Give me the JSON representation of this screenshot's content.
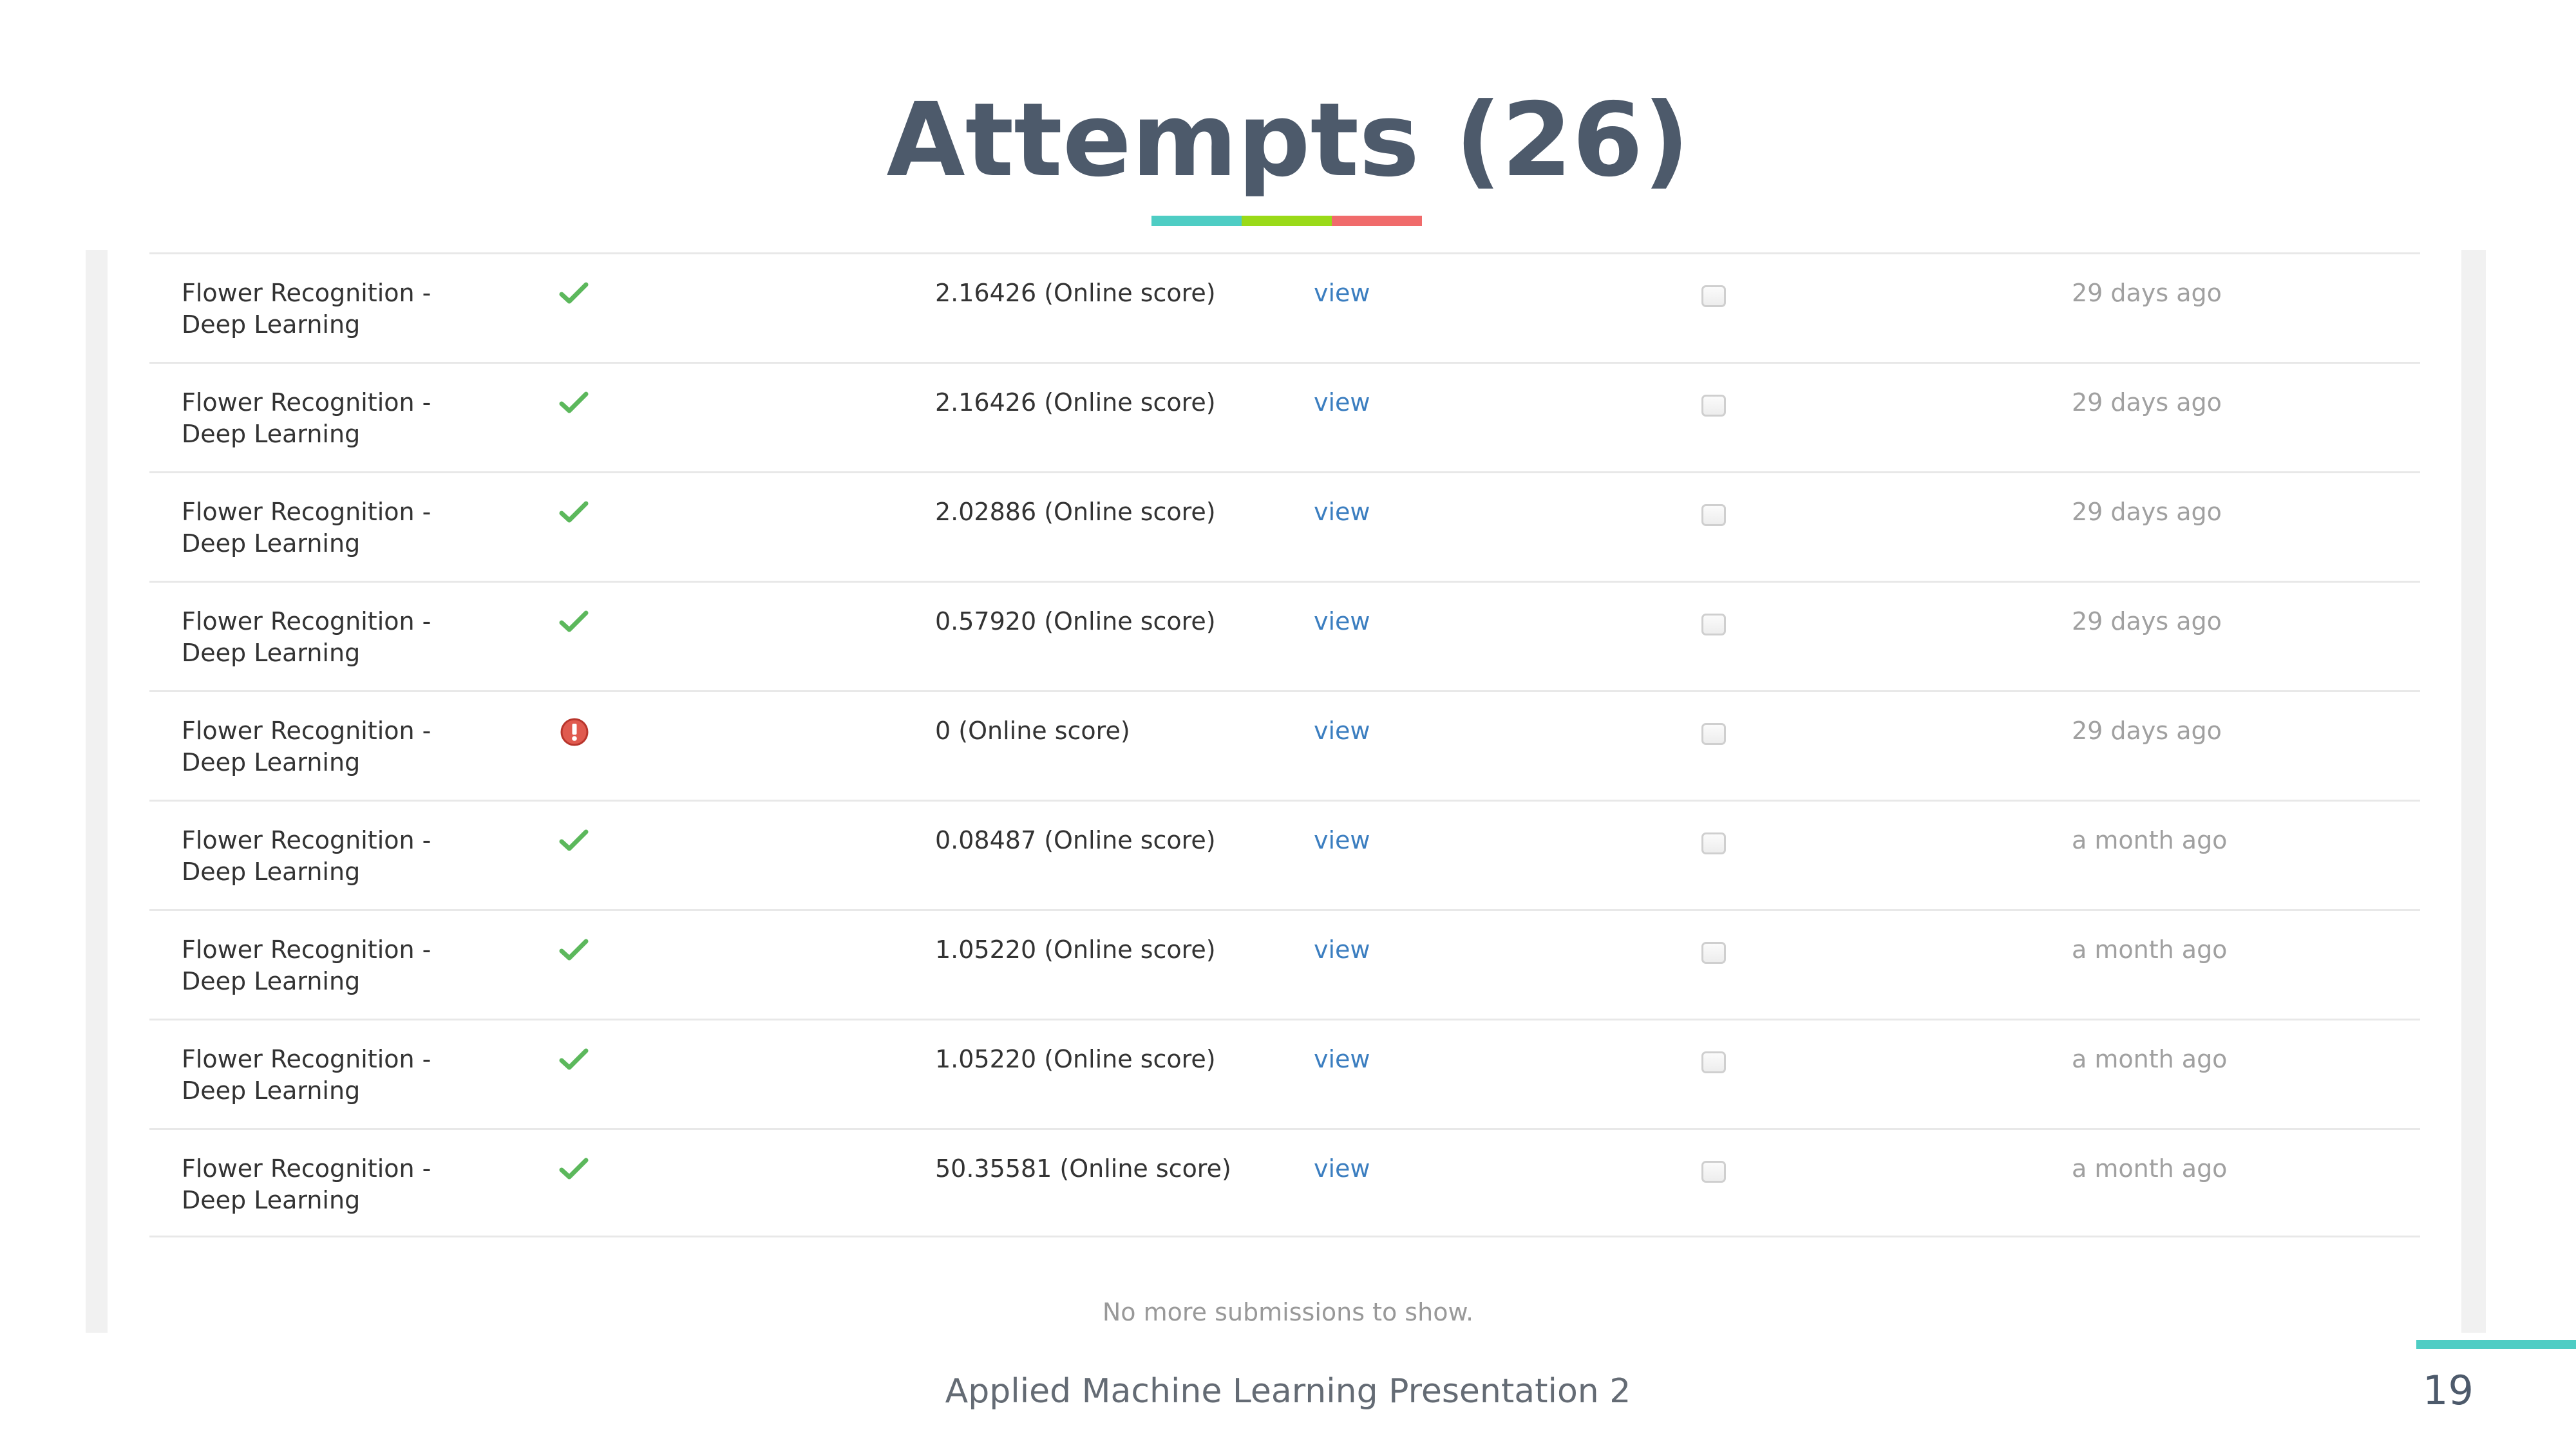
{
  "slide": {
    "title": "Attempts (26)",
    "footer": "Applied Machine Learning Presentation 2",
    "page_number": "19",
    "accent_colors": [
      "#4ecdc4",
      "#9ada18",
      "#f06b6b"
    ]
  },
  "table": {
    "rows": [
      {
        "name_line1": "Flower Recognition -",
        "name_line2": "Deep Learning",
        "status": "check-icon",
        "score": "2.16426 (Online score)",
        "link": "view",
        "time": "29 days ago"
      },
      {
        "name_line1": "Flower Recognition -",
        "name_line2": "Deep Learning",
        "status": "check-icon",
        "score": "2.16426 (Online score)",
        "link": "view",
        "time": "29 days ago"
      },
      {
        "name_line1": "Flower Recognition -",
        "name_line2": "Deep Learning",
        "status": "check-icon",
        "score": "2.02886 (Online score)",
        "link": "view",
        "time": "29 days ago"
      },
      {
        "name_line1": "Flower Recognition -",
        "name_line2": "Deep Learning",
        "status": "check-icon",
        "score": "0.57920 (Online score)",
        "link": "view",
        "time": "29 days ago"
      },
      {
        "name_line1": "Flower Recognition -",
        "name_line2": "Deep Learning",
        "status": "error-icon",
        "score": "0 (Online score)",
        "link": "view",
        "time": "29 days ago"
      },
      {
        "name_line1": "Flower Recognition -",
        "name_line2": "Deep Learning",
        "status": "check-icon",
        "score": "0.08487 (Online score)",
        "link": "view",
        "time": "a month ago"
      },
      {
        "name_line1": "Flower Recognition -",
        "name_line2": "Deep Learning",
        "status": "check-icon",
        "score": "1.05220 (Online score)",
        "link": "view",
        "time": "a month ago"
      },
      {
        "name_line1": "Flower Recognition -",
        "name_line2": "Deep Learning",
        "status": "check-icon",
        "score": "1.05220 (Online score)",
        "link": "view",
        "time": "a month ago"
      },
      {
        "name_line1": "Flower Recognition -",
        "name_line2": "Deep Learning",
        "status": "check-icon",
        "score": "50.35581 (Online score)",
        "link": "view",
        "time": "a month ago"
      }
    ],
    "empty_message": "No more submissions to show.",
    "colors": {
      "success": "#5cb85c",
      "error": "#d9534f",
      "link": "#3b7ec0"
    }
  }
}
